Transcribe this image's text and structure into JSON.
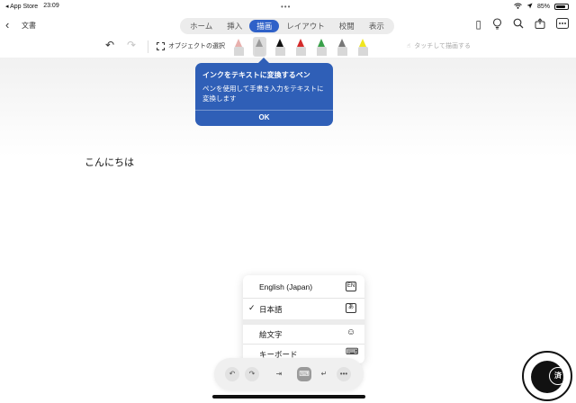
{
  "status_bar": {
    "app": "◂ App Store",
    "time": "23:09",
    "dots": "•••",
    "battery_text": "85%",
    "battery_level": 0.85
  },
  "header": {
    "title": "文書",
    "tabs": [
      {
        "label": "ホーム",
        "active": false
      },
      {
        "label": "挿入",
        "active": false
      },
      {
        "label": "描画",
        "active": true
      },
      {
        "label": "レイアウト",
        "active": false
      },
      {
        "label": "校閲",
        "active": false
      },
      {
        "label": "表示",
        "active": false
      }
    ]
  },
  "toolbar": {
    "select_label": "オブジェクトの選択",
    "touch_label": "タッチして描画する",
    "pens": [
      {
        "name": "eraser",
        "color": "#e8b0ad"
      },
      {
        "name": "ink-to-text-pen",
        "color": "#9a9a9a"
      },
      {
        "name": "black-pen",
        "color": "#111111"
      },
      {
        "name": "red-pen",
        "color": "#d42a2a"
      },
      {
        "name": "green-pen",
        "color": "#3aa04a"
      },
      {
        "name": "grey-pen",
        "color": "#777777"
      },
      {
        "name": "yellow-highlighter",
        "color": "#f0e61f"
      }
    ]
  },
  "tooltip": {
    "title": "インクをテキストに変換するペン",
    "body": "ペンを使用して手書き入力をテキストに変換します",
    "ok": "OK"
  },
  "document": {
    "text": "こんにちは"
  },
  "language_menu": {
    "items": [
      {
        "label": "English (Japan)",
        "checked": false,
        "key": "EN"
      },
      {
        "label": "日本語",
        "checked": true,
        "key": "あ"
      },
      {
        "label": "絵文字",
        "checked": false,
        "key": "☺"
      },
      {
        "label": "キーボード",
        "checked": false,
        "key": "⌨"
      }
    ]
  },
  "watermark": {
    "text": "済"
  }
}
